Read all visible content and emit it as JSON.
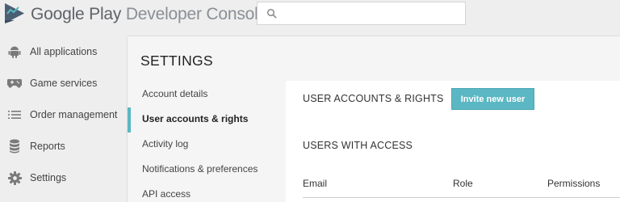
{
  "header": {
    "brand_primary": "Google Play",
    "brand_secondary": "Developer Console",
    "logo_icon": "play-developer-logo-icon",
    "search": {
      "icon": "search-icon",
      "value": "",
      "placeholder": ""
    }
  },
  "sidebar": {
    "items": [
      {
        "label": "All applications",
        "icon": "android-icon"
      },
      {
        "label": "Game services",
        "icon": "gamepad-icon"
      },
      {
        "label": "Order management",
        "icon": "list-icon"
      },
      {
        "label": "Reports",
        "icon": "database-icon"
      },
      {
        "label": "Settings",
        "icon": "gear-icon"
      }
    ]
  },
  "settings": {
    "title": "SETTINGS",
    "menu": [
      {
        "label": "Account details",
        "active": false
      },
      {
        "label": "User accounts & rights",
        "active": true
      },
      {
        "label": "Activity log",
        "active": false
      },
      {
        "label": "Notifications & preferences",
        "active": false
      },
      {
        "label": "API access",
        "active": false
      }
    ]
  },
  "content": {
    "user_accounts_heading": "USER ACCOUNTS & RIGHTS",
    "invite_label": "Invite new user",
    "users_with_access_heading": "USERS WITH ACCESS",
    "table_headers": [
      "Email",
      "Role",
      "Permissions"
    ]
  },
  "colors": {
    "accent": "#5bb7c3",
    "background": "#eeeeee",
    "panel": "#f5f5f5",
    "logo_dark": "#4a5f73",
    "logo_light": "#5bb7c3"
  }
}
